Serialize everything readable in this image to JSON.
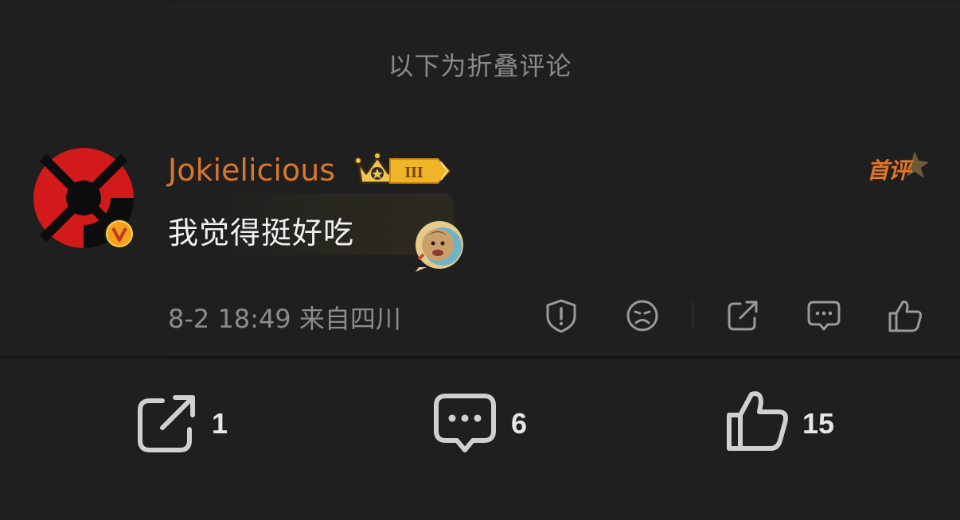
{
  "fold_notice": "以下为折叠评论",
  "comment": {
    "username": "Jokielicious",
    "level_badge": "III",
    "first_comment_badge": "首评",
    "text": "我觉得挺好吃",
    "meta": "8-2 18:49 来自四川",
    "actions": [
      "report-icon",
      "dislike-icon",
      "share-icon",
      "reply-icon",
      "like-icon"
    ]
  },
  "footer": {
    "share_count": "1",
    "comment_count": "6",
    "like_count": "15"
  },
  "colors": {
    "background": "#1f1f1f",
    "username": "#d8772f",
    "first_badge": "#e0762a",
    "meta_text": "#8c8c8c",
    "comment_text": "#f0f0f0"
  }
}
